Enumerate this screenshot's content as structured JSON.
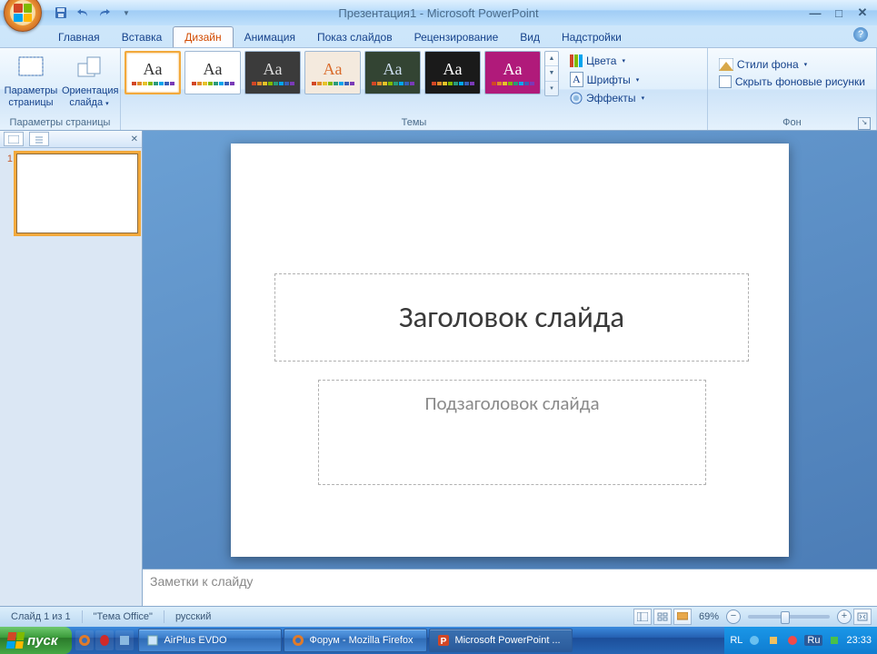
{
  "title": "Презентация1 - Microsoft PowerPoint",
  "tabs": [
    "Главная",
    "Вставка",
    "Дизайн",
    "Анимация",
    "Показ слайдов",
    "Рецензирование",
    "Вид",
    "Надстройки"
  ],
  "active_tab": 2,
  "ribbon": {
    "page_setup": {
      "title": "Параметры страницы",
      "page_setup": "Параметры страницы",
      "orientation": "Ориентация слайда"
    },
    "themes": {
      "title": "Темы",
      "items": [
        {
          "bg": "#ffffff",
          "fg": "#333333",
          "name": "office"
        },
        {
          "bg": "#ffffff",
          "fg": "#333333",
          "name": "light"
        },
        {
          "bg": "#3b3b3b",
          "fg": "#dddddd",
          "name": "dark-gray"
        },
        {
          "bg": "#f4eade",
          "fg": "#d86b2c",
          "name": "orange"
        },
        {
          "bg": "#334433",
          "fg": "#cde",
          "name": "green-dark"
        },
        {
          "bg": "#1a1a1a",
          "fg": "#ffffff",
          "name": "black"
        },
        {
          "bg": "#b01a7a",
          "fg": "#ffffff",
          "name": "magenta"
        }
      ],
      "colors": "Цвета",
      "fonts": "Шрифты",
      "effects": "Эффекты"
    },
    "background": {
      "title": "Фон",
      "styles": "Стили фона",
      "hide": "Скрыть фоновые рисунки"
    }
  },
  "slide": {
    "title": "Заголовок слайда",
    "subtitle": "Подзаголовок слайда"
  },
  "notes_placeholder": "Заметки к слайду",
  "status": {
    "slide_info": "Слайд 1 из 1",
    "theme": "\"Тема Office\"",
    "lang": "русский",
    "zoom": "69%"
  },
  "taskbar": {
    "start": "пуск",
    "items": [
      {
        "icon": "app",
        "label": "AirPlus EVDO"
      },
      {
        "icon": "firefox",
        "label": "Форум - Mozilla Firefox"
      },
      {
        "icon": "powerpoint",
        "label": "Microsoft PowerPoint ..."
      }
    ],
    "tray": {
      "lang1": "RL",
      "lang2": "Ru",
      "time": "23:33"
    }
  }
}
